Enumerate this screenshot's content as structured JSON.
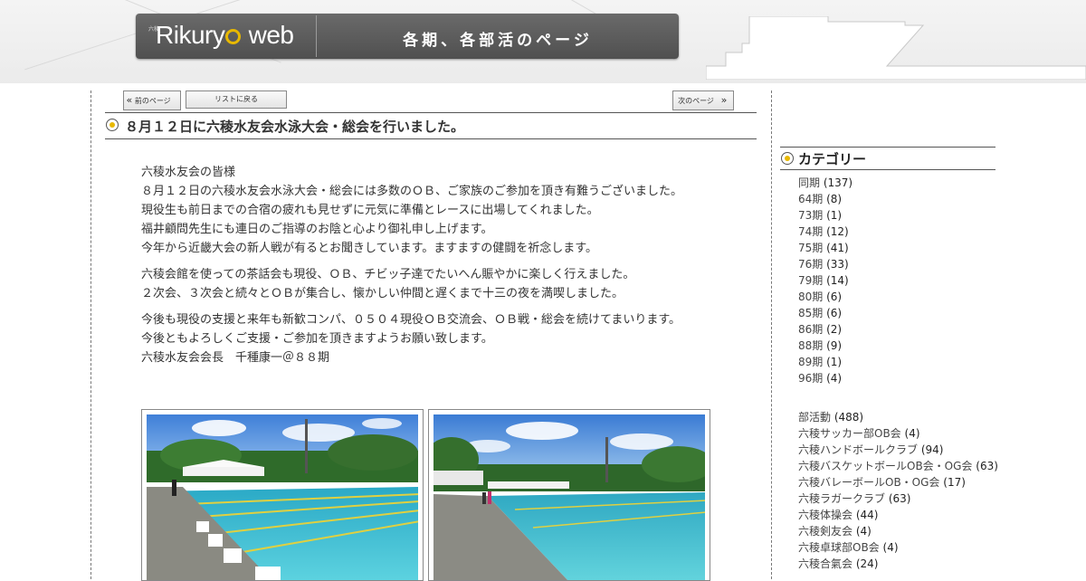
{
  "header": {
    "logo_text_a": "Rikury",
    "logo_text_b": " web",
    "logo_small": "六稜",
    "title": "各期、各部活のページ"
  },
  "nav": {
    "prev_label": "前のページ",
    "prev_arrow": "«",
    "list_label": "リストに戻る",
    "next_label": "次のページ",
    "next_arrow": "»"
  },
  "post": {
    "title": "８月１２日に六稜水友会水泳大会・総会を行いました。",
    "paragraphs": [
      [
        "六稜水友会の皆様",
        "８月１２日の六稜水友会水泳大会・総会には多数のＯＢ、ご家族のご参加を頂き有難うございました。",
        "現役生も前日までの合宿の疲れも見せずに元気に準備とレースに出場してくれました。",
        "福井顧問先生にも連日のご指導のお陰と心より御礼申し上げます。",
        "今年から近畿大会の新人戦が有るとお聞きしています。ますますの健闘を祈念します。"
      ],
      [
        "六稜会館を使っての茶話会も現役、ＯＢ、チビッ子達でたいへん賑やかに楽しく行えました。",
        "２次会、３次会と続々とＯＢが集合し、懐かしい仲間と遅くまで十三の夜を満喫しました。"
      ],
      [
        "今後も現役の支援と来年も新歓コンパ、０５０４現役ＯＢ交流会、ＯＢ戦・総会を続けてまいります。",
        "今後ともよろしくご支援・ご参加を頂きますようお願い致します。",
        "六稜水友会会長　千種康一＠８８期"
      ]
    ]
  },
  "sidebar": {
    "heading": "カテゴリー",
    "group1": [
      {
        "name": "同期",
        "count": "(137)"
      },
      {
        "name": "64期",
        "count": "(8)"
      },
      {
        "name": "73期",
        "count": "(1)"
      },
      {
        "name": "74期",
        "count": "(12)"
      },
      {
        "name": "75期",
        "count": "(41)"
      },
      {
        "name": "76期",
        "count": "(33)"
      },
      {
        "name": "79期",
        "count": "(14)"
      },
      {
        "name": "80期",
        "count": "(6)"
      },
      {
        "name": "85期",
        "count": "(6)"
      },
      {
        "name": "86期",
        "count": "(2)"
      },
      {
        "name": "88期",
        "count": "(9)"
      },
      {
        "name": "89期",
        "count": "(1)"
      },
      {
        "name": "96期",
        "count": "(4)"
      }
    ],
    "group2": [
      {
        "name": "部活動",
        "count": "(488)"
      },
      {
        "name": "六稜サッカー部OB会",
        "count": "(4)"
      },
      {
        "name": "六稜ハンドボールクラブ",
        "count": "(94)"
      },
      {
        "name": "六稜バスケットボールOB会・OG会",
        "count": "(63)"
      },
      {
        "name": "六稜バレーボールOB・OG会",
        "count": "(17)"
      },
      {
        "name": "六稜ラガークラブ",
        "count": "(63)"
      },
      {
        "name": "六稜体操会",
        "count": "(44)"
      },
      {
        "name": "六稜剣友会",
        "count": "(4)"
      },
      {
        "name": "六稜卓球部OB会",
        "count": "(4)"
      },
      {
        "name": "六稜合氣会",
        "count": "(24)"
      }
    ]
  }
}
